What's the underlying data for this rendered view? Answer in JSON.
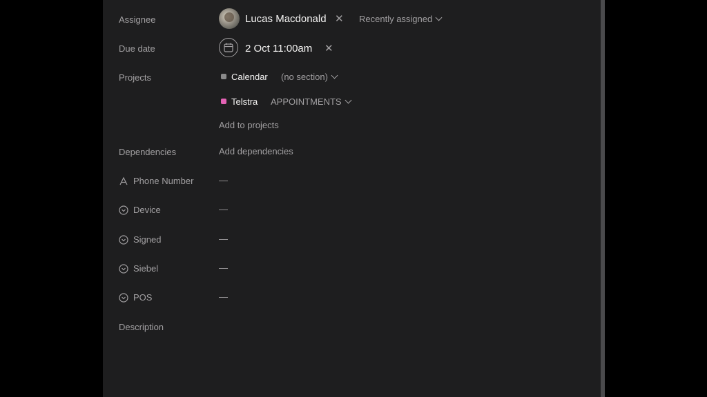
{
  "assignee": {
    "label": "Assignee",
    "name": "Lucas Macdonald",
    "remove": "✕",
    "recently_assigned": "Recently assigned"
  },
  "due_date": {
    "label": "Due date",
    "value": "2 Oct 11:00am",
    "remove": "✕"
  },
  "projects": {
    "label": "Projects",
    "items": [
      {
        "name": "Calendar",
        "section": "(no section)",
        "color": "#8a8a8a"
      },
      {
        "name": "Telstra",
        "section": "APPOINTMENTS",
        "color": "#e362b4"
      }
    ],
    "add_label": "Add to projects"
  },
  "dependencies": {
    "label": "Dependencies",
    "add_label": "Add dependencies"
  },
  "fields": [
    {
      "label": "Phone Number",
      "value": "—",
      "icon": "text-field-icon"
    },
    {
      "label": "Device",
      "value": "—",
      "icon": "dropdown-field-icon"
    },
    {
      "label": "Signed",
      "value": "—",
      "icon": "dropdown-field-icon"
    },
    {
      "label": "Siebel",
      "value": "—",
      "icon": "dropdown-field-icon"
    },
    {
      "label": "POS",
      "value": "—",
      "icon": "dropdown-field-icon"
    }
  ],
  "description": {
    "label": "Description"
  }
}
